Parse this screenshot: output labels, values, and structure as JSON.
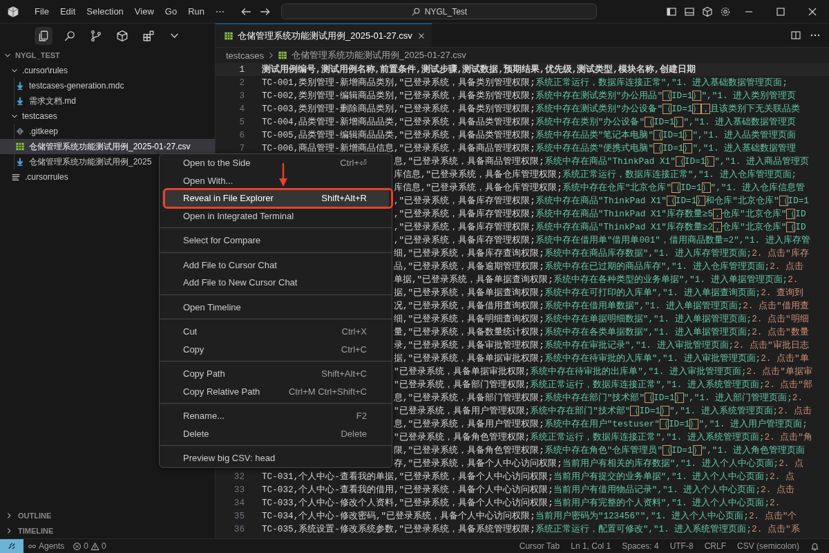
{
  "menu_bar": [
    "File",
    "Edit",
    "Selection",
    "View",
    "Go",
    "Run",
    "⋯"
  ],
  "command_center": {
    "label": "NYGL_Test"
  },
  "activity_views": [
    {
      "kind": "files",
      "selected": true
    },
    {
      "kind": "search",
      "selected": false
    },
    {
      "kind": "git",
      "selected": false
    },
    {
      "kind": "cube",
      "selected": false
    },
    {
      "kind": "extensions",
      "selected": false
    },
    {
      "kind": "more",
      "selected": false
    }
  ],
  "explorer": {
    "root": "NYGL_TEST",
    "expanded": true,
    "items": [
      {
        "label": ".cursor\\rules",
        "kind": "folder",
        "expanded": true,
        "selected": false,
        "children": [
          {
            "label": "testcases-generation.mdc",
            "kind": "md",
            "selected": false
          },
          {
            "label": "需求文档.md",
            "kind": "md",
            "selected": false
          }
        ]
      },
      {
        "label": "testcases",
        "kind": "folder",
        "expanded": true,
        "selected": false,
        "children": [
          {
            "label": ".gitkeep",
            "kind": "git",
            "selected": false
          },
          {
            "label": "仓储管理系统功能测试用例_2025-01-27.csv",
            "kind": "csv",
            "selected": true
          },
          {
            "label": "仓储管理系统功能测试用例_2025",
            "kind": "md",
            "selected": false
          }
        ]
      },
      {
        "label": ".cursorrules",
        "kind": "lines",
        "selected": false
      }
    ]
  },
  "panels": [
    {
      "label": "OUTLINE",
      "expanded": false
    },
    {
      "label": "TIMELINE",
      "expanded": false
    }
  ],
  "tabs": [
    {
      "label": "仓储管理系统功能测试用例_2025-01-27.csv",
      "selected": true
    }
  ],
  "breadcrumb": [
    {
      "label": "testcases",
      "kind": "folder"
    },
    {
      "label": "仓储管理系统功能测试用例_2025-01-27.csv",
      "kind": "csv"
    }
  ],
  "editor": {
    "lines": [
      {
        "kind": "full",
        "number": "1",
        "current": true,
        "text": "测试用例编号,测试用例名称,前置条件,测试步骤,测试数据,预期结果,优先级,测试类型,模块名称,创建日期"
      },
      {
        "kind": "full",
        "number": "2",
        "current": false,
        "text": "TC-001,类别管理-新增商品类别,\"已登录系统，具备类别管理权限;系统正常运行，数据库连接正常\",\"1. 进入基础数据管理页面;"
      },
      {
        "kind": "full",
        "number": "3",
        "current": false,
        "text": "TC-002,类别管理-编辑商品类别,\"已登录系统，具备类别管理权限;系统中存在测试类别\"办公用品\"（ID=1）\",\"1. 进入类别管理页"
      },
      {
        "kind": "full",
        "number": "4",
        "current": false,
        "text": "TC-003,类别管理-删除商品类别,\"已登录系统，具备类别管理权限;系统中存在测试类别\"办公设备\"（ID=1），且该类别下无关联品类"
      },
      {
        "kind": "full",
        "number": "5",
        "current": false,
        "text": "TC-004,品类管理-新增商品品类,\"已登录系统，具备品类管理权限;系统中存在类别\"办公设备\"（ID=1）\",\"1. 进入基础数据管理页"
      },
      {
        "kind": "full",
        "number": "6",
        "current": false,
        "text": "TC-005,品类管理-编辑商品品类,\"已登录系统，具备品类管理权限;系统中存在品类\"笔记本电脑\"（ID=1）\",\"1. 进入品类管理页面"
      },
      {
        "kind": "full",
        "number": "7",
        "current": false,
        "text": "TC-006,商品管理-新增商品信息,\"已登录系统，具备商品管理权限;系统中存在品类\"便携式电脑\"（ID=1）\",\"1. 进入基础数据管理"
      },
      {
        "kind": "tail",
        "text": "息,\"已登录系统，具备商品管理权限;系统中存在商品\"ThinkPad X1\"（ID=1）\",\"1. 进入商品管理页"
      },
      {
        "kind": "tail",
        "text": "库信息,\"已登录系统，具备仓库管理权限;系统正常运行，数据库连接正常\",\"1. 进入仓库管理页面;"
      },
      {
        "kind": "tail",
        "text": "库信息,\"已登录系统，具备仓库管理权限;系统中存在仓库\"北京仓库\"（ID=1）\",\"1. 进入仓库信息管"
      },
      {
        "kind": "tail",
        "text": ",\"已登录系统，具备库存管理权限;系统中存在商品\"ThinkPad X1\"（ID=1）和仓库\"北京仓库\"（ID=1"
      },
      {
        "kind": "tail",
        "text": ",\"已登录系统，具备库存管理权限;系统中存在商品\"ThinkPad X1\"库存数量≥5，仓库\"北京仓库\"（ID"
      },
      {
        "kind": "tail",
        "text": ",\"已登录系统，具备库存管理权限;系统中存在商品\"ThinkPad X1\"库存数量≥2，仓库\"北京仓库\"（ID"
      },
      {
        "kind": "tail",
        "text": ",\"已登录系统，具备库存管理权限;系统中存在借用单\"借用单001\"，借用商品数量=2\",\"1. 进入库存管"
      },
      {
        "kind": "tail",
        "text": "细,\"已登录系统，具备库存查询权限;系统中存在商品库存数据\",\"1. 进入库存管理页面;2. 点击\"库存"
      },
      {
        "kind": "tail",
        "text": "品,\"已登录系统，具备逾期管理权限;系统中存在已过期的商品库存\",\"1. 进入仓库管理页面;2. 点击"
      },
      {
        "kind": "tail",
        "text": "单据,\"已登录系统，具备单据查询权限;系统中存在各种类型的业务单据\",\"1. 进入单据管理页面;2."
      },
      {
        "kind": "tail",
        "text": "据,\"已登录系统，具备单据查询权限;系统中存在可打印的入库单\",\"1. 进入单据查询页面;2. 查询到"
      },
      {
        "kind": "tail",
        "text": "况,\"已登录系统，具备借用查询权限;系统中存在借用单数据\",\"1. 进入单据管理页面;2. 点击\"借用查"
      },
      {
        "kind": "tail",
        "text": "细,\"已登录系统，具备明细查询权限;系统中存在单据明细数据\",\"1. 进入单据管理页面;2. 点击\"明细"
      },
      {
        "kind": "tail",
        "text": "量,\"已登录系统，具备数量统计权限;系统中存在各类单据数据\",\"1. 进入单据管理页面;2. 点击\"数量"
      },
      {
        "kind": "tail",
        "text": "录,\"已登录系统，具备审批管理权限;系统中存在审批记录\",\"1. 进入审批管理页面;2. 点击\"审批日志"
      },
      {
        "kind": "tail",
        "text": "据,\"已登录系统，具备单据审批权限;系统中存在待审批的入库单\",\"1. 进入审批管理页面;2. 点击\"单"
      },
      {
        "kind": "tail",
        "text": "\"已登录系统，具备单据审批权限;系统中存在待审批的出库单\",\"1. 进入审批管理页面;2. 点击\"单据审"
      },
      {
        "kind": "tail",
        "text": "\"已登录系统，具备部门管理权限;系统正常运行，数据库连接正常\",\"1. 进入系统管理页面;2. 点击\"部"
      },
      {
        "kind": "tail",
        "text": "息,\"已登录系统，具备部门管理权限;系统中存在部门\"技术部\"（ID=1）\",\"1. 进入部门管理页面;2."
      },
      {
        "kind": "tail",
        "text": "\"已登录系统，具备用户管理权限;系统中存在部门\"技术部\"（ID=1）\",\"1. 进入系统管理页面;2. 点击"
      },
      {
        "kind": "tail",
        "text": "息,\"已登录系统，具备用户管理权限;系统中存在用户\"testuser\"（ID=1）\",\"1. 进入用户管理页面;"
      },
      {
        "kind": "tail",
        "text": "\"已登录系统，具备角色管理权限;系统正常运行，数据库连接正常\",\"1. 进入系统管理页面;2. 点击\"角"
      },
      {
        "kind": "tail",
        "text": "限,\"已登录系统，具备角色管理权限;系统中存在角色\"仓库管理员\"（ID=1）\",\"1. 进入角色管理页面"
      },
      {
        "kind": "tail",
        "text": "存,\"已登录系统，具备个人中心访问权限;当前用户有相关的库存数据\",\"1. 进入个人中心页面;2. 点"
      },
      {
        "kind": "full",
        "number": "32",
        "current": false,
        "text": "TC-031,个人中心-查看我的单据,\"已登录系统，具备个人中心访问权限;当前用户有提交的业务单据\",\"1. 进入个人中心页面;2. 点"
      },
      {
        "kind": "full",
        "number": "33",
        "current": false,
        "text": "TC-032,个人中心-查看我的借用,\"已登录系统，具备个人中心访问权限;当前用户有借用物品记录\",\"1. 进入个人中心页面;2. 点击"
      },
      {
        "kind": "full",
        "number": "34",
        "current": false,
        "text": "TC-033,个人中心-修改个人资料,\"已登录系统，具备个人中心访问权限;当前用户有完整的个人资料\",\"1. 进入个人中心页面;2."
      },
      {
        "kind": "full",
        "number": "35",
        "current": false,
        "text": "TC-034,个人中心-修改密码,\"已登录系统，具备个人中心访问权限;当前用户密码为\"123456\"\",\"1. 进入个人中心页面;2. 点击\"个"
      },
      {
        "kind": "full",
        "number": "36",
        "current": false,
        "text": "TC-035,系统设置-修改系统参数,\"已登录系统，具备系统管理权限;系统正常运行，配置可修改\",\"1. 进入系统管理页面;2. 点击\"系"
      }
    ]
  },
  "context_menu": {
    "groups": [
      [
        {
          "label": "Open to the Side",
          "shortcut": "Ctrl+⏎",
          "selected": false,
          "callout": false
        },
        {
          "label": "Open With...",
          "selected": false,
          "callout": false
        },
        {
          "label": "Reveal in File Explorer",
          "shortcut": "Shift+Alt+R",
          "selected": true,
          "callout": true
        },
        {
          "label": "Open in Integrated Terminal",
          "selected": false,
          "callout": false
        }
      ],
      [
        {
          "label": "Select for Compare",
          "selected": false,
          "callout": false
        }
      ],
      [
        {
          "label": "Add File to Cursor Chat",
          "selected": false,
          "callout": false
        },
        {
          "label": "Add File to New Cursor Chat",
          "selected": false,
          "callout": false
        }
      ],
      [
        {
          "label": "Open Timeline",
          "selected": false,
          "callout": false
        }
      ],
      [
        {
          "label": "Cut",
          "shortcut": "Ctrl+X",
          "selected": false,
          "callout": false
        },
        {
          "label": "Copy",
          "shortcut": "Ctrl+C",
          "selected": false,
          "callout": false
        }
      ],
      [
        {
          "label": "Copy Path",
          "shortcut": "Shift+Alt+C",
          "selected": false,
          "callout": false
        },
        {
          "label": "Copy Relative Path",
          "shortcut": "Ctrl+M Ctrl+Shift+C",
          "selected": false,
          "callout": false
        }
      ],
      [
        {
          "label": "Rename...",
          "shortcut": "F2",
          "selected": false,
          "callout": false
        },
        {
          "label": "Delete",
          "shortcut": "Delete",
          "selected": false,
          "callout": false
        }
      ],
      [
        {
          "label": "Preview big CSV: head",
          "selected": false,
          "callout": false
        }
      ]
    ]
  },
  "status_bar": {
    "left": [
      {
        "kind": "remote"
      },
      {
        "kind": "agents",
        "label": "Agents"
      },
      {
        "kind": "problems",
        "errors": "0",
        "warnings": "0"
      }
    ],
    "right": [
      {
        "kind": "text",
        "label": "Cursor Tab"
      },
      {
        "kind": "text",
        "label": "Ln 1, Col 1"
      },
      {
        "kind": "text",
        "label": "Spaces: 4"
      },
      {
        "kind": "text",
        "label": "UTF-8"
      },
      {
        "kind": "text",
        "label": "CRLF"
      },
      {
        "kind": "text",
        "label": "CSV (semicolon)"
      },
      {
        "kind": "bell"
      }
    ]
  }
}
